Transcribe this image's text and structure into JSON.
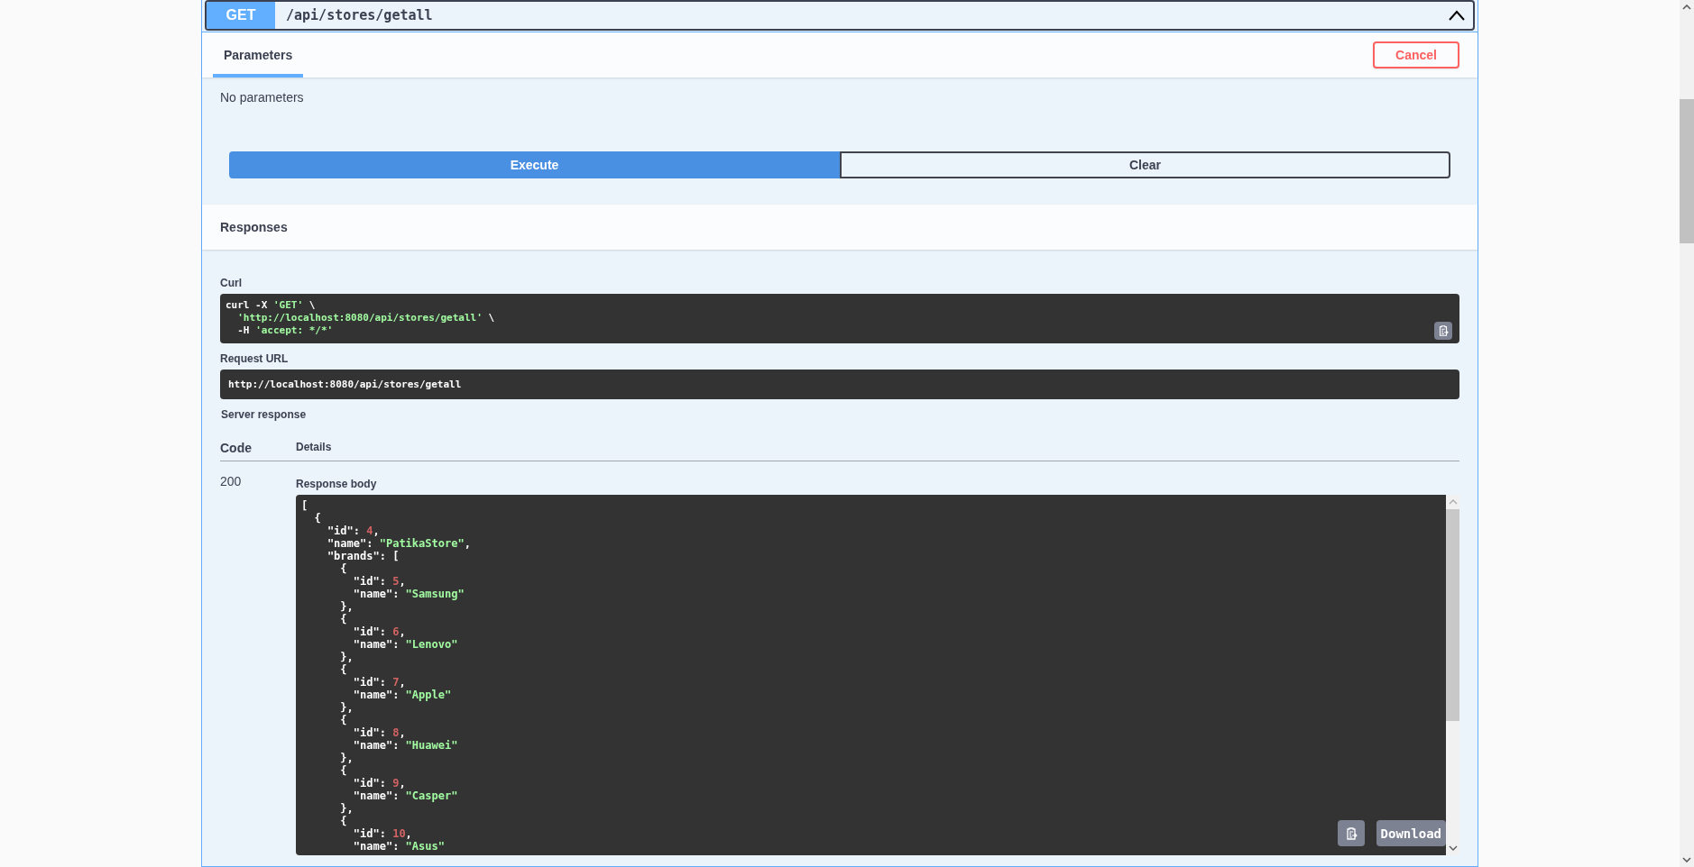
{
  "endpoint": {
    "method": "GET",
    "path": "/api/stores/getall",
    "expanded": true
  },
  "parameters": {
    "tabs": [
      {
        "label": "Parameters",
        "selected": true
      }
    ],
    "cancel_button": "Cancel",
    "message": "No parameters"
  },
  "actions": [
    {
      "label": "Execute",
      "kind": "primary"
    },
    {
      "label": "Clear",
      "kind": "secondary"
    }
  ],
  "responses": {
    "title": "Responses",
    "curl": {
      "label": "Curl",
      "lines": [
        {
          "tokens": [
            {
              "kind": "plain",
              "text": "curl -X "
            },
            {
              "kind": "string",
              "text": "'GET'"
            },
            {
              "kind": "plain",
              "text": " \\"
            }
          ]
        },
        {
          "tokens": [
            {
              "kind": "string",
              "text": "  'http://localhost:8080/api/stores/getall'"
            },
            {
              "kind": "plain",
              "text": " \\"
            }
          ]
        },
        {
          "tokens": [
            {
              "kind": "plain",
              "text": "  -H "
            },
            {
              "kind": "string",
              "text": "'accept: */*'"
            }
          ]
        }
      ]
    },
    "request_url": {
      "label": "Request URL",
      "value": "http://localhost:8080/api/stores/getall"
    },
    "server_response": {
      "label": "Server response",
      "columns": [
        "Code",
        "Details"
      ],
      "code": "200",
      "body_label": "Response body",
      "download_button": "Download",
      "body_lines": [
        {
          "tokens": [
            {
              "kind": "plain",
              "text": "["
            }
          ]
        },
        {
          "tokens": [
            {
              "kind": "plain",
              "text": "  {"
            }
          ]
        },
        {
          "tokens": [
            {
              "kind": "plain",
              "text": "    \"id\": "
            },
            {
              "kind": "number",
              "text": "4"
            },
            {
              "kind": "plain",
              "text": ","
            }
          ]
        },
        {
          "tokens": [
            {
              "kind": "plain",
              "text": "    \"name\": "
            },
            {
              "kind": "string",
              "text": "\"PatikaStore\""
            },
            {
              "kind": "plain",
              "text": ","
            }
          ]
        },
        {
          "tokens": [
            {
              "kind": "plain",
              "text": "    \"brands\": ["
            }
          ]
        },
        {
          "tokens": [
            {
              "kind": "plain",
              "text": "      {"
            }
          ]
        },
        {
          "tokens": [
            {
              "kind": "plain",
              "text": "        \"id\": "
            },
            {
              "kind": "number",
              "text": "5"
            },
            {
              "kind": "plain",
              "text": ","
            }
          ]
        },
        {
          "tokens": [
            {
              "kind": "plain",
              "text": "        \"name\": "
            },
            {
              "kind": "string",
              "text": "\"Samsung\""
            }
          ]
        },
        {
          "tokens": [
            {
              "kind": "plain",
              "text": "      },"
            }
          ]
        },
        {
          "tokens": [
            {
              "kind": "plain",
              "text": "      {"
            }
          ]
        },
        {
          "tokens": [
            {
              "kind": "plain",
              "text": "        \"id\": "
            },
            {
              "kind": "number",
              "text": "6"
            },
            {
              "kind": "plain",
              "text": ","
            }
          ]
        },
        {
          "tokens": [
            {
              "kind": "plain",
              "text": "        \"name\": "
            },
            {
              "kind": "string",
              "text": "\"Lenovo\""
            }
          ]
        },
        {
          "tokens": [
            {
              "kind": "plain",
              "text": "      },"
            }
          ]
        },
        {
          "tokens": [
            {
              "kind": "plain",
              "text": "      {"
            }
          ]
        },
        {
          "tokens": [
            {
              "kind": "plain",
              "text": "        \"id\": "
            },
            {
              "kind": "number",
              "text": "7"
            },
            {
              "kind": "plain",
              "text": ","
            }
          ]
        },
        {
          "tokens": [
            {
              "kind": "plain",
              "text": "        \"name\": "
            },
            {
              "kind": "string",
              "text": "\"Apple\""
            }
          ]
        },
        {
          "tokens": [
            {
              "kind": "plain",
              "text": "      },"
            }
          ]
        },
        {
          "tokens": [
            {
              "kind": "plain",
              "text": "      {"
            }
          ]
        },
        {
          "tokens": [
            {
              "kind": "plain",
              "text": "        \"id\": "
            },
            {
              "kind": "number",
              "text": "8"
            },
            {
              "kind": "plain",
              "text": ","
            }
          ]
        },
        {
          "tokens": [
            {
              "kind": "plain",
              "text": "        \"name\": "
            },
            {
              "kind": "string",
              "text": "\"Huawei\""
            }
          ]
        },
        {
          "tokens": [
            {
              "kind": "plain",
              "text": "      },"
            }
          ]
        },
        {
          "tokens": [
            {
              "kind": "plain",
              "text": "      {"
            }
          ]
        },
        {
          "tokens": [
            {
              "kind": "plain",
              "text": "        \"id\": "
            },
            {
              "kind": "number",
              "text": "9"
            },
            {
              "kind": "plain",
              "text": ","
            }
          ]
        },
        {
          "tokens": [
            {
              "kind": "plain",
              "text": "        \"name\": "
            },
            {
              "kind": "string",
              "text": "\"Casper\""
            }
          ]
        },
        {
          "tokens": [
            {
              "kind": "plain",
              "text": "      },"
            }
          ]
        },
        {
          "tokens": [
            {
              "kind": "plain",
              "text": "      {"
            }
          ]
        },
        {
          "tokens": [
            {
              "kind": "plain",
              "text": "        \"id\": "
            },
            {
              "kind": "number",
              "text": "10"
            },
            {
              "kind": "plain",
              "text": ","
            }
          ]
        },
        {
          "tokens": [
            {
              "kind": "plain",
              "text": "        \"name\": "
            },
            {
              "kind": "string",
              "text": "\"Asus\""
            }
          ]
        }
      ]
    }
  }
}
